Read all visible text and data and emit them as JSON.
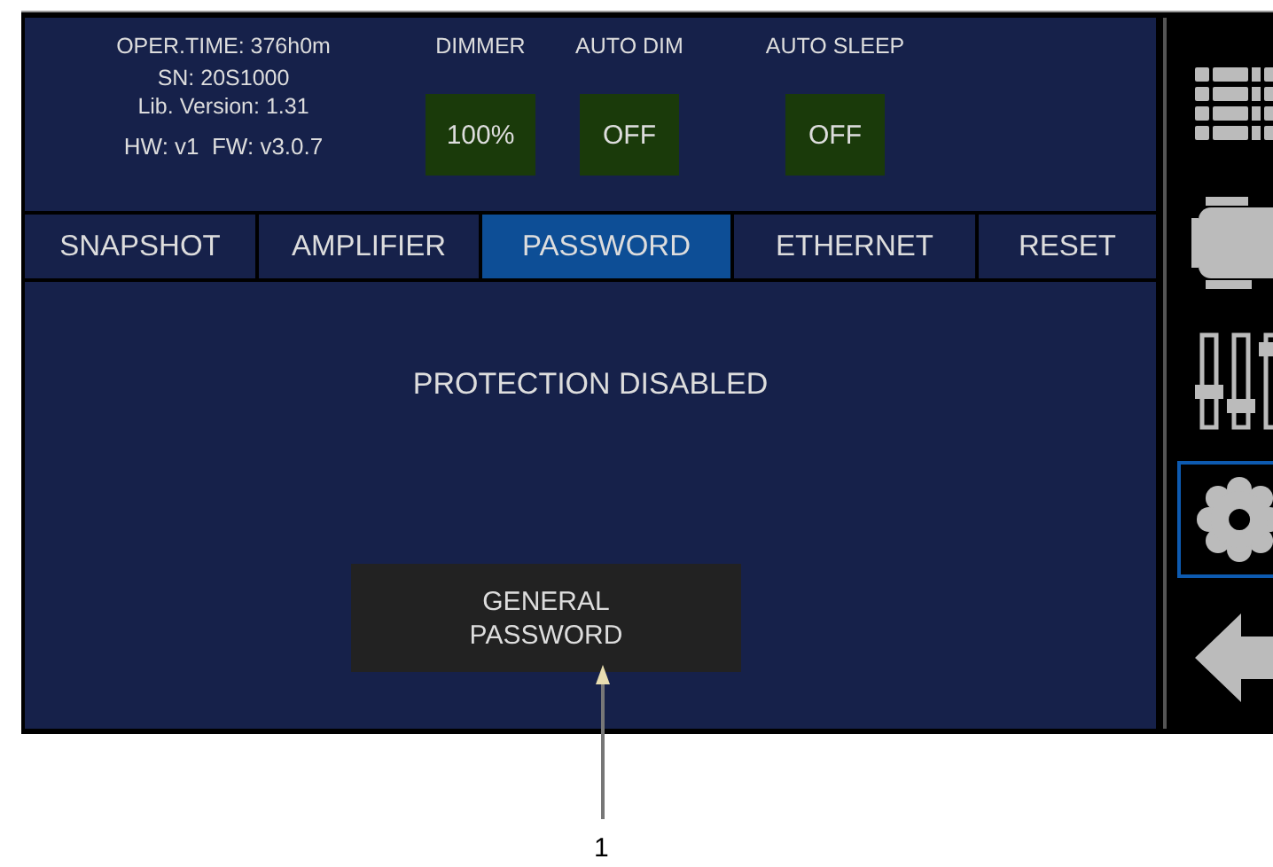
{
  "status": {
    "oper_time": "OPER.TIME: 376h0m",
    "serial": "SN: 20S1000",
    "lib_version": "Lib. Version: 1.31",
    "hw_fw": "HW: v1  FW: v3.0.7"
  },
  "settings": [
    {
      "label": "DIMMER",
      "value": "100%"
    },
    {
      "label": "AUTO DIM",
      "value": "OFF"
    },
    {
      "label": "AUTO SLEEP",
      "value": "OFF"
    }
  ],
  "tabs": [
    {
      "label": "SNAPSHOT",
      "selected": false
    },
    {
      "label": "AMPLIFIER",
      "selected": false
    },
    {
      "label": "PASSWORD",
      "selected": true
    },
    {
      "label": "ETHERNET",
      "selected": false
    },
    {
      "label": "RESET",
      "selected": false
    }
  ],
  "message": "PROTECTION DISABLED",
  "button": "GENERAL PASSWORD",
  "sidebar": [
    {
      "kind": "rack",
      "selected": false
    },
    {
      "kind": "chip",
      "selected": false
    },
    {
      "kind": "faders",
      "selected": false
    },
    {
      "kind": "gear",
      "selected": true
    },
    {
      "kind": "back",
      "selected": false
    }
  ],
  "callout": {
    "label": "1"
  }
}
